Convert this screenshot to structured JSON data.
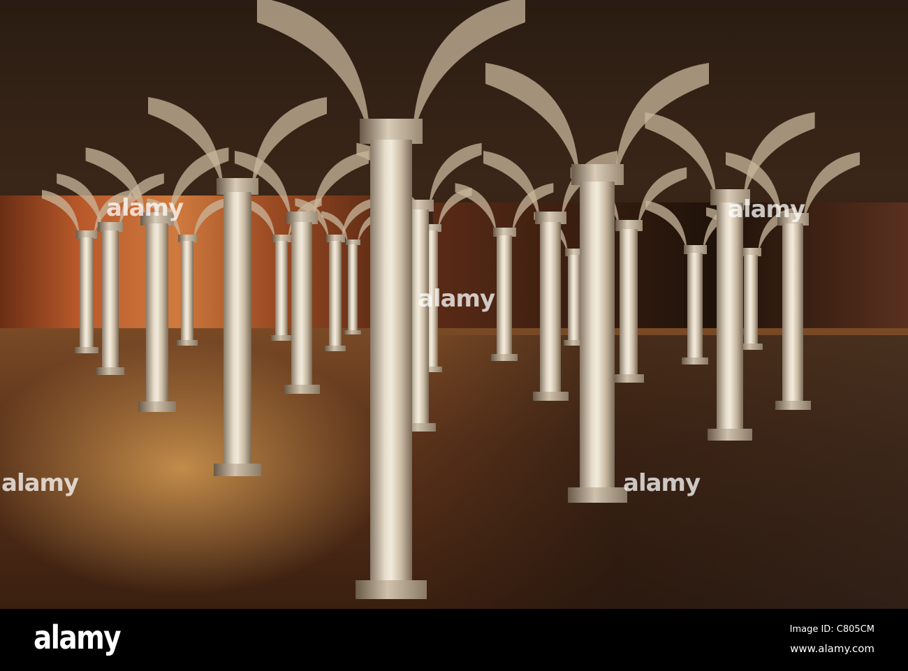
{
  "photo": {
    "subject": "crypt with columns",
    "watermark_text": "alamy",
    "watermarks_visible": [
      "alamy",
      "alamy",
      "alamy",
      "alamy",
      "alamy"
    ]
  },
  "footer": {
    "logo": "alamy",
    "image_id": "Image ID: C805CM",
    "website": "www.alamy.com"
  }
}
